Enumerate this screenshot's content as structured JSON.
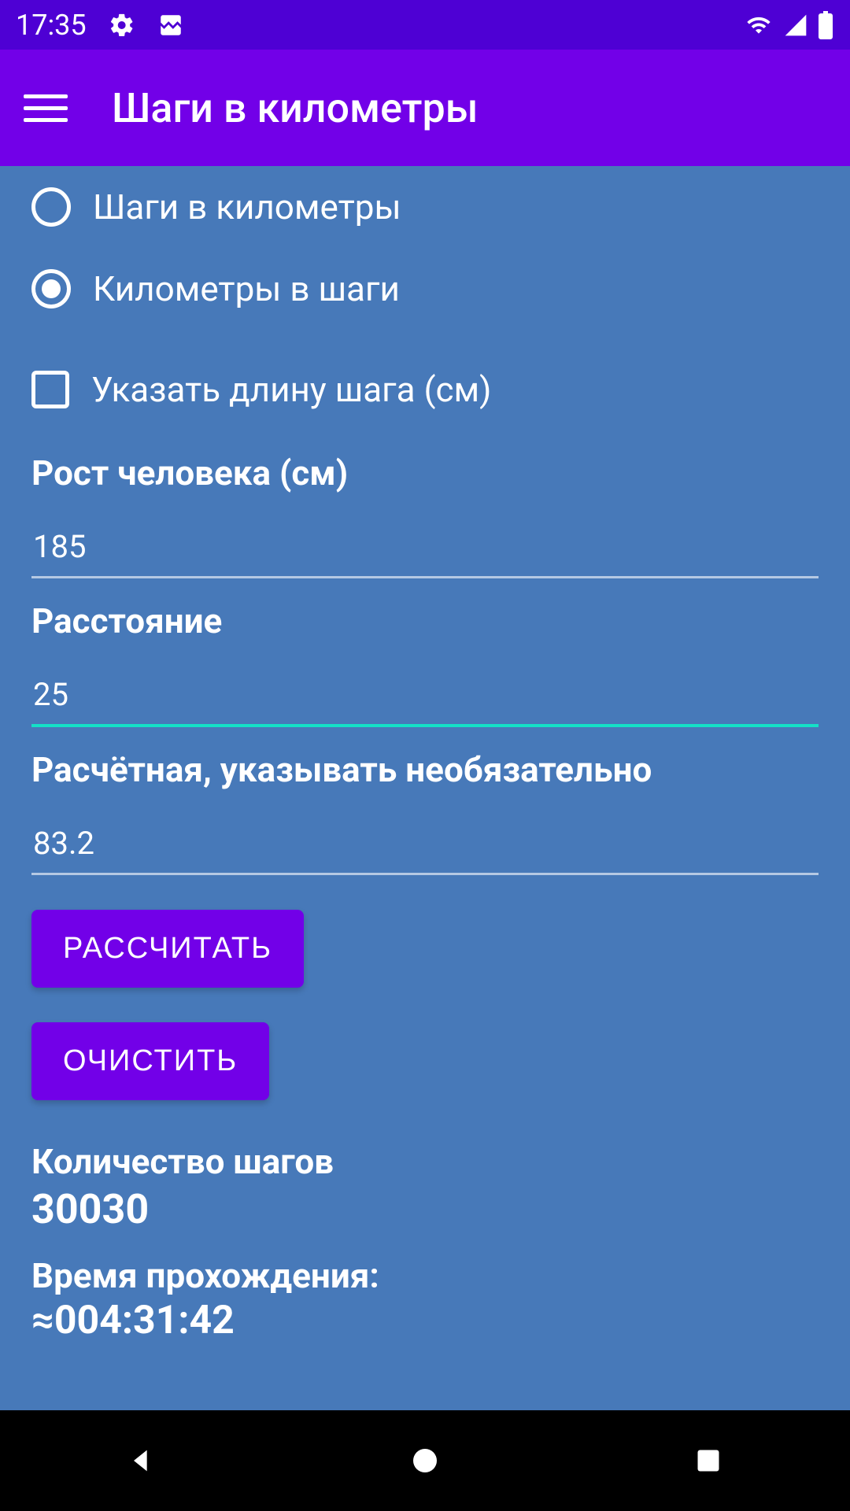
{
  "status": {
    "time": "17:35"
  },
  "appbar": {
    "title": "Шаги в километры"
  },
  "radios": {
    "option1": "Шаги в километры",
    "option2": "Километры в шаги"
  },
  "checkbox": {
    "label": "Указать длину шага (см)"
  },
  "fields": {
    "height_label": "Рост человека (см)",
    "height_value": "185",
    "distance_label": "Расстояние",
    "distance_value": "25",
    "calculated_label": "Расчётная, указывать необязательно",
    "calculated_value": "83.2"
  },
  "buttons": {
    "calculate": "РАССЧИТАТЬ",
    "clear": "ОЧИСТИТЬ"
  },
  "results": {
    "steps_label": "Количество шагов",
    "steps_value": "30030",
    "time_label": "Время прохождения:",
    "time_value": "≈004:31:42"
  }
}
